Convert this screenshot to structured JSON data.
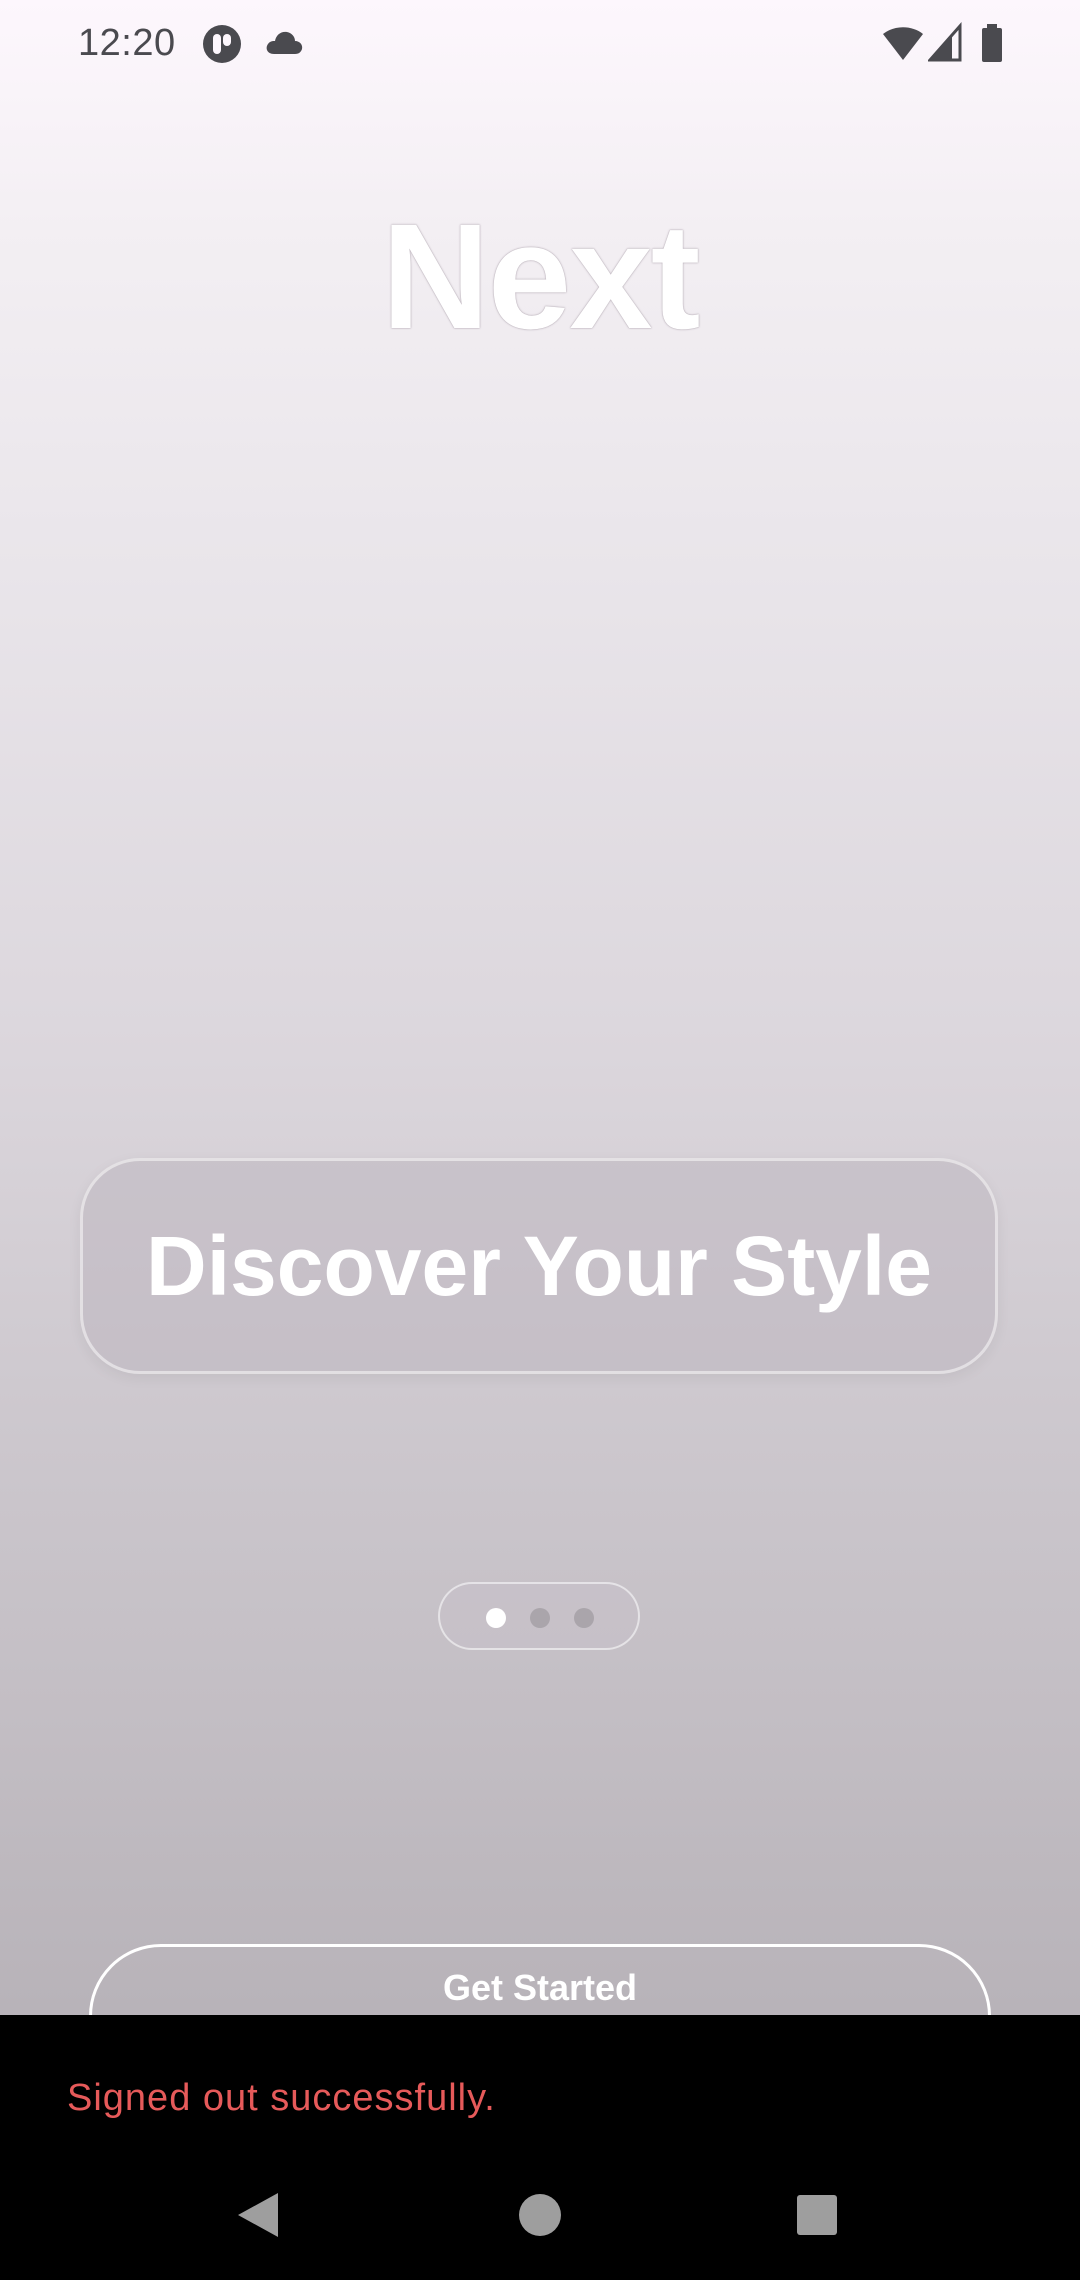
{
  "status_bar": {
    "time": "12:20",
    "left_icons": [
      "app-notification-icon",
      "cloud-icon"
    ],
    "right_icons": [
      "wifi-icon",
      "cellular-signal-icon",
      "battery-icon"
    ],
    "icon_color": "#4a4a4f"
  },
  "hero": {
    "title": "Next"
  },
  "card": {
    "text": "Discover Your Style"
  },
  "page_indicator": {
    "total": 3,
    "active_index": 0,
    "active_color": "#ffffff",
    "inactive_color": "#aaa5ab"
  },
  "cta": {
    "label": "Get Started"
  },
  "snackbar": {
    "message": "Signed out successfully.",
    "text_color": "#e65a5a",
    "background": "#000000"
  },
  "nav_bar": {
    "buttons": [
      "back-icon",
      "home-icon",
      "recents-icon"
    ],
    "icon_color": "#9e9e9e"
  }
}
